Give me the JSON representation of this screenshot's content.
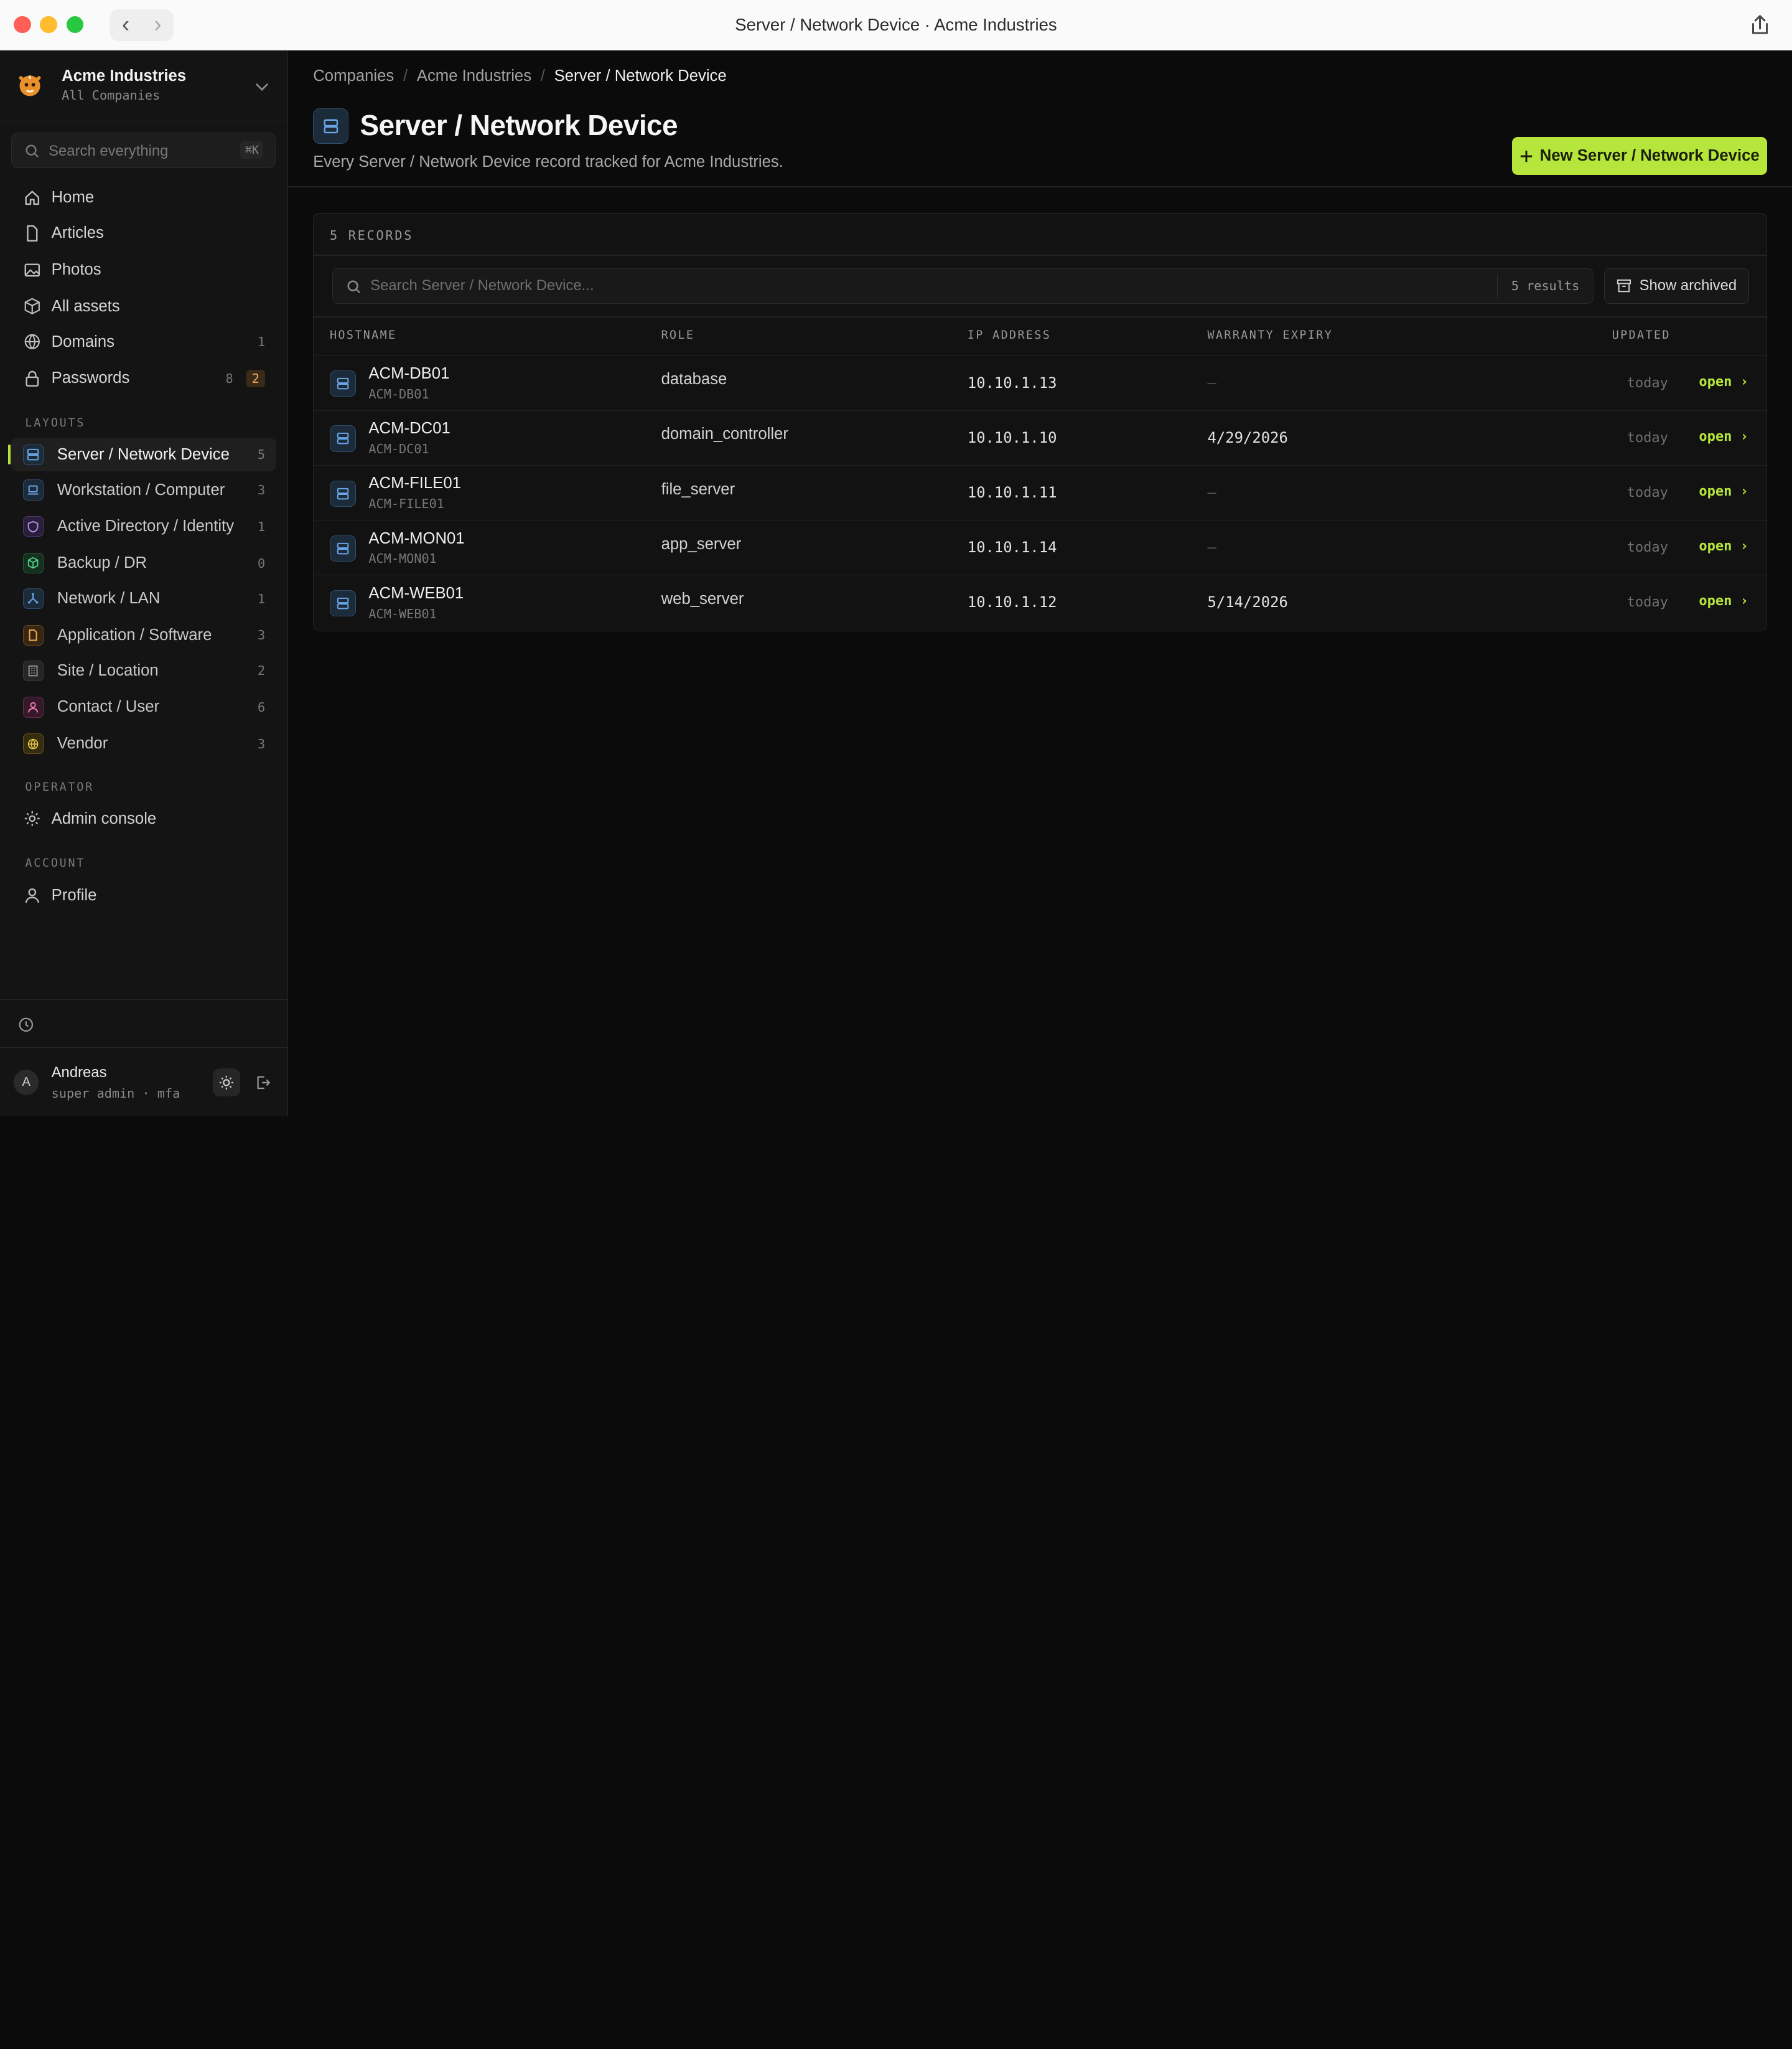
{
  "window": {
    "title": "Server / Network Device · Acme Industries"
  },
  "org": {
    "name": "Acme Industries",
    "subtitle": "All Companies"
  },
  "sidebar": {
    "search_placeholder": "Search everything",
    "search_shortcut": "⌘K",
    "nav": [
      {
        "label": "Home",
        "icon": "home-icon"
      },
      {
        "label": "Articles",
        "icon": "document-icon"
      },
      {
        "label": "Photos",
        "icon": "image-icon"
      },
      {
        "label": "All assets",
        "icon": "box-icon"
      },
      {
        "label": "Domains",
        "icon": "globe-icon",
        "count": "1"
      },
      {
        "label": "Passwords",
        "icon": "lock-icon",
        "count": "8",
        "badge": "2"
      }
    ],
    "layouts_label": "LAYOUTS",
    "layouts": [
      {
        "label": "Server / Network Device",
        "count": "5",
        "icon": "server-icon",
        "color": "#4f8fd6"
      },
      {
        "label": "Workstation / Computer",
        "count": "3",
        "icon": "laptop-icon",
        "color": "#4f8fd6"
      },
      {
        "label": "Active Directory / Identity",
        "count": "1",
        "icon": "shield-icon",
        "color": "#9a6bd8"
      },
      {
        "label": "Backup / DR",
        "count": "0",
        "icon": "cube-icon",
        "color": "#3fb16a"
      },
      {
        "label": "Network / LAN",
        "count": "1",
        "icon": "network-icon",
        "color": "#4f8fd6"
      },
      {
        "label": "Application / Software",
        "count": "3",
        "icon": "file-icon",
        "color": "#e0963c"
      },
      {
        "label": "Site / Location",
        "count": "2",
        "icon": "building-icon",
        "color": "#8a8a8a"
      },
      {
        "label": "Contact / User",
        "count": "6",
        "icon": "user-icon",
        "color": "#d85b8a"
      },
      {
        "label": "Vendor",
        "count": "3",
        "icon": "globe-icon",
        "color": "#d9b634"
      }
    ],
    "operator_label": "OPERATOR",
    "operator_item": "Admin console",
    "account_label": "ACCOUNT",
    "account_item": "Profile"
  },
  "user": {
    "initial": "A",
    "name": "Andreas",
    "role": "super admin · mfa"
  },
  "breadcrumbs": [
    "Companies",
    "Acme Industries",
    "Server / Network Device"
  ],
  "page": {
    "title": "Server / Network Device",
    "description": "Every Server / Network Device record tracked for Acme Industries.",
    "new_button": "New Server / Network Device"
  },
  "table": {
    "records_label": "5 RECORDS",
    "search_placeholder": "Search Server / Network Device...",
    "results": "5 results",
    "show_archived": "Show archived",
    "columns": [
      "HOSTNAME",
      "ROLE",
      "IP ADDRESS",
      "WARRANTY EXPIRY",
      "UPDATED"
    ],
    "rows": [
      {
        "hostname": "ACM-DB01",
        "slug": "ACM-DB01",
        "role": "database",
        "ip": "10.10.1.13",
        "warranty": "—",
        "updated": "today",
        "action": "open ›"
      },
      {
        "hostname": "ACM-DC01",
        "slug": "ACM-DC01",
        "role": "domain_controller",
        "ip": "10.10.1.10",
        "warranty": "4/29/2026",
        "updated": "today",
        "action": "open ›"
      },
      {
        "hostname": "ACM-FILE01",
        "slug": "ACM-FILE01",
        "role": "file_server",
        "ip": "10.10.1.11",
        "warranty": "—",
        "updated": "today",
        "action": "open ›"
      },
      {
        "hostname": "ACM-MON01",
        "slug": "ACM-MON01",
        "role": "app_server",
        "ip": "10.10.1.14",
        "warranty": "—",
        "updated": "today",
        "action": "open ›"
      },
      {
        "hostname": "ACM-WEB01",
        "slug": "ACM-WEB01",
        "role": "web_server",
        "ip": "10.10.1.12",
        "warranty": "5/14/2026",
        "updated": "today",
        "action": "open ›"
      }
    ]
  },
  "colors": {
    "accent": "#b6e63b",
    "background": "#0b0b0b",
    "sidebar": "#141414"
  }
}
